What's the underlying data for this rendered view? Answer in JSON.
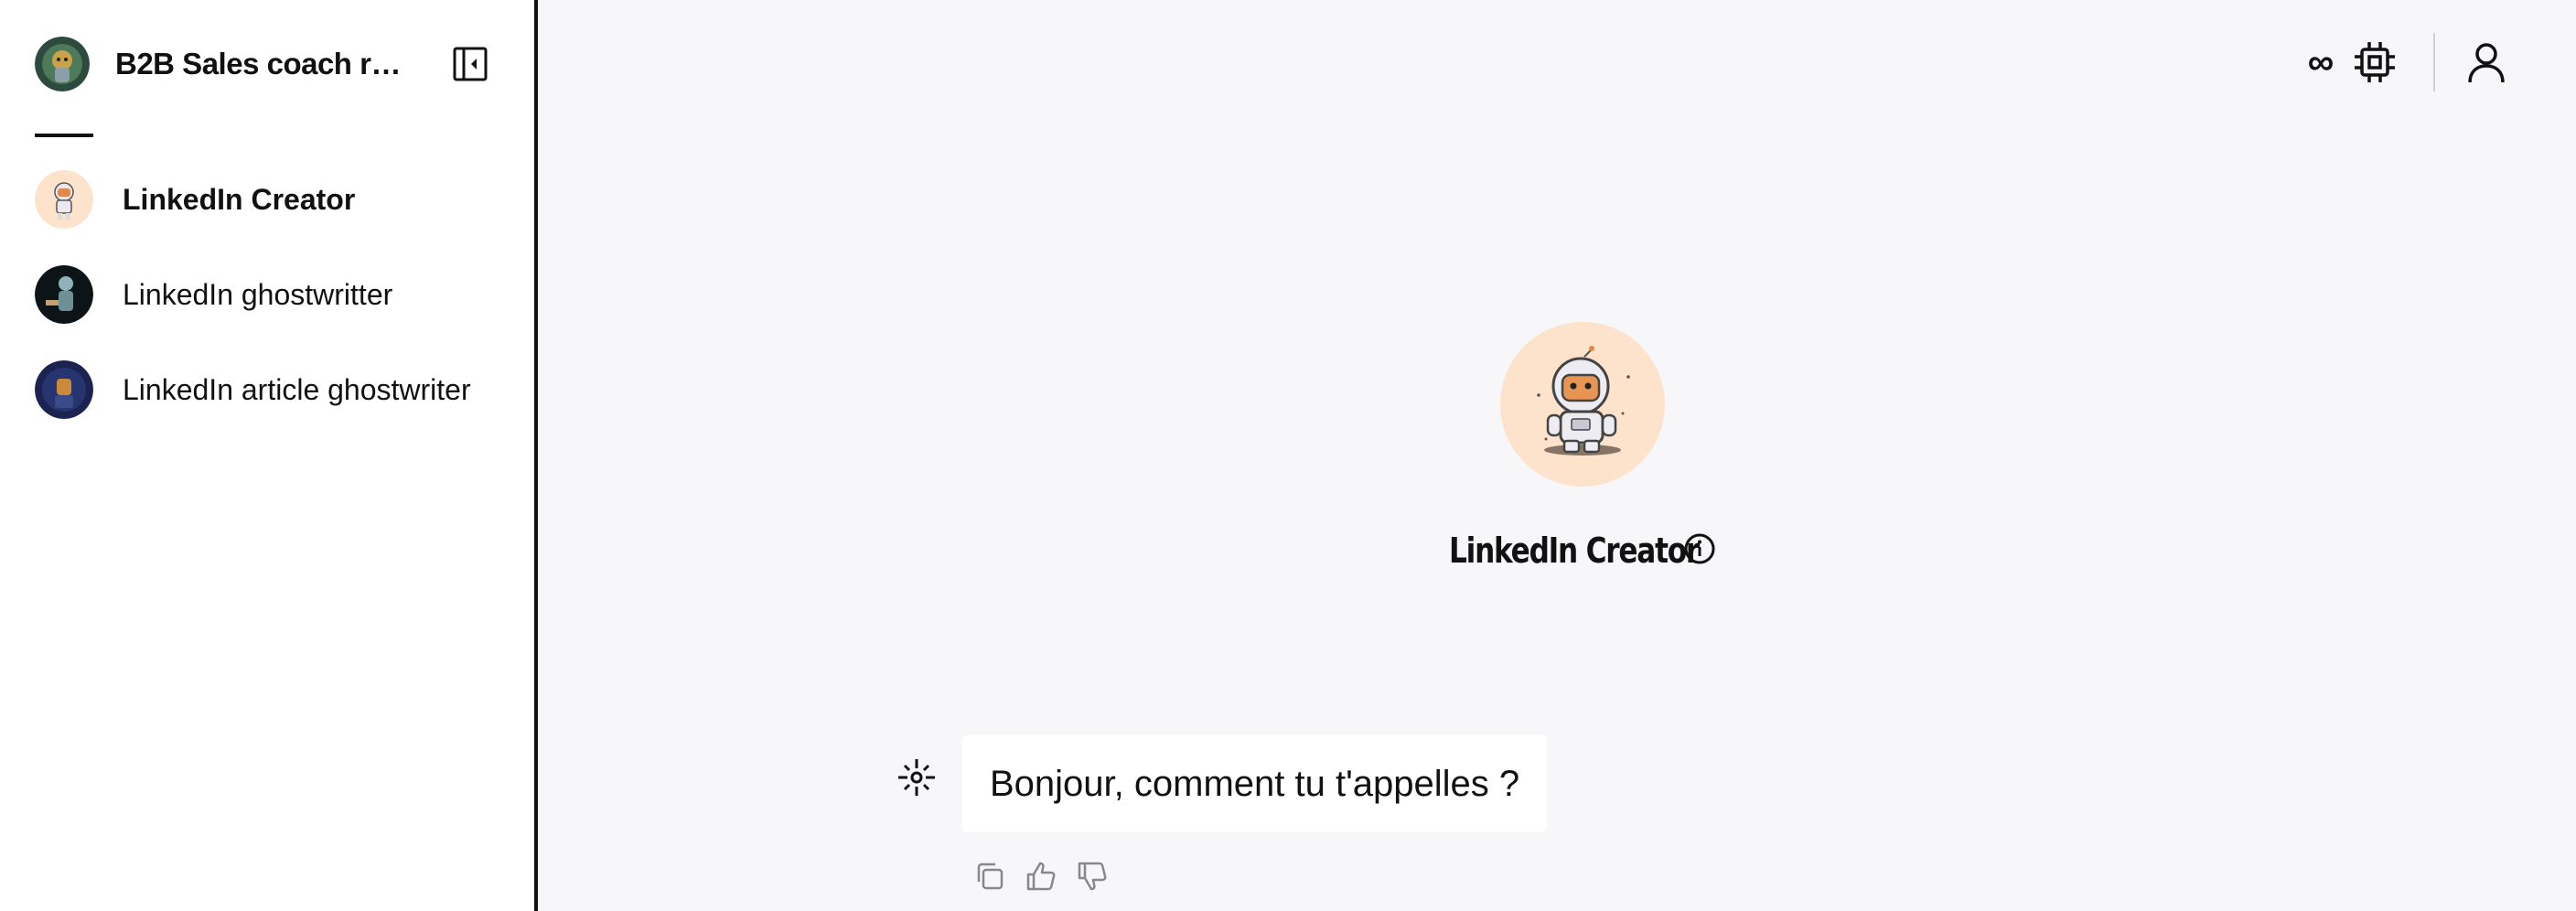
{
  "sidebar": {
    "title": "B2B Sales coach ro...",
    "items": [
      {
        "label": "LinkedIn Creator",
        "active": true
      },
      {
        "label": "LinkedIn ghostwritter",
        "active": false
      },
      {
        "label": "LinkedIn article ghostwriter",
        "active": false
      }
    ]
  },
  "topbar": {
    "infinity_label": "∞"
  },
  "bot": {
    "name": "LinkedIn Creator"
  },
  "messages": [
    {
      "role": "bot",
      "text": "Bonjour, comment tu t'appelles ?"
    }
  ],
  "icons": {
    "collapse": "sidebar-collapse-icon",
    "chip": "cpu-chip-icon",
    "user": "user-icon",
    "info": "info-icon",
    "bot": "sparkle-bot-icon",
    "copy": "copy-icon",
    "like": "thumbs-up-icon",
    "dislike": "thumbs-down-icon"
  },
  "colors": {
    "background": "#f7f7f9",
    "sidebar": "#ffffff",
    "hero_avatar_bg": "#fde3cc",
    "text": "#111111"
  }
}
